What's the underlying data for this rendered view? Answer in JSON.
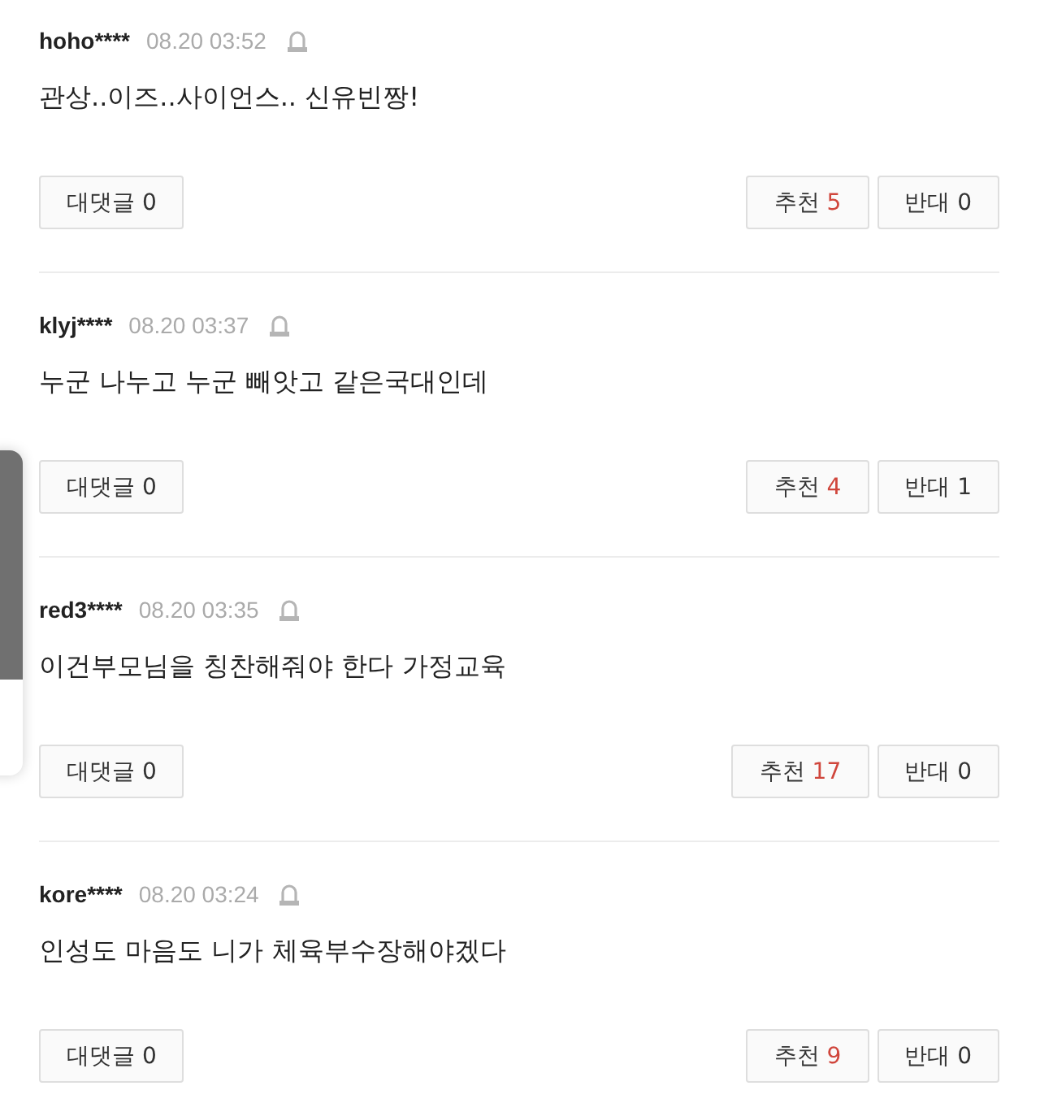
{
  "comments": [
    {
      "user": "hoho****",
      "time": "08.20 03:52",
      "text": "관상..이즈..사이언스.. 신유빈짱!",
      "reply": {
        "label": "대댓글",
        "count": "0"
      },
      "like": {
        "label": "추천",
        "count": "5"
      },
      "dislike": {
        "label": "반대",
        "count": "0"
      }
    },
    {
      "user": "klyj****",
      "time": "08.20 03:37",
      "text": "누군 나누고 누군 빼앗고 같은국대인데",
      "reply": {
        "label": "대댓글",
        "count": "0"
      },
      "like": {
        "label": "추천",
        "count": "4"
      },
      "dislike": {
        "label": "반대",
        "count": "1"
      }
    },
    {
      "user": "red3****",
      "time": "08.20 03:35",
      "text": "이건부모님을 칭찬해줘야 한다 가정교육",
      "reply": {
        "label": "대댓글",
        "count": "0"
      },
      "like": {
        "label": "추천",
        "count": "17"
      },
      "dislike": {
        "label": "반대",
        "count": "0"
      }
    },
    {
      "user": "kore****",
      "time": "08.20 03:24",
      "text": "인성도 마음도 니가 체육부수장해야겠다",
      "reply": {
        "label": "대댓글",
        "count": "0"
      },
      "like": {
        "label": "추천",
        "count": "9"
      },
      "dislike": {
        "label": "반대",
        "count": "0"
      }
    }
  ]
}
